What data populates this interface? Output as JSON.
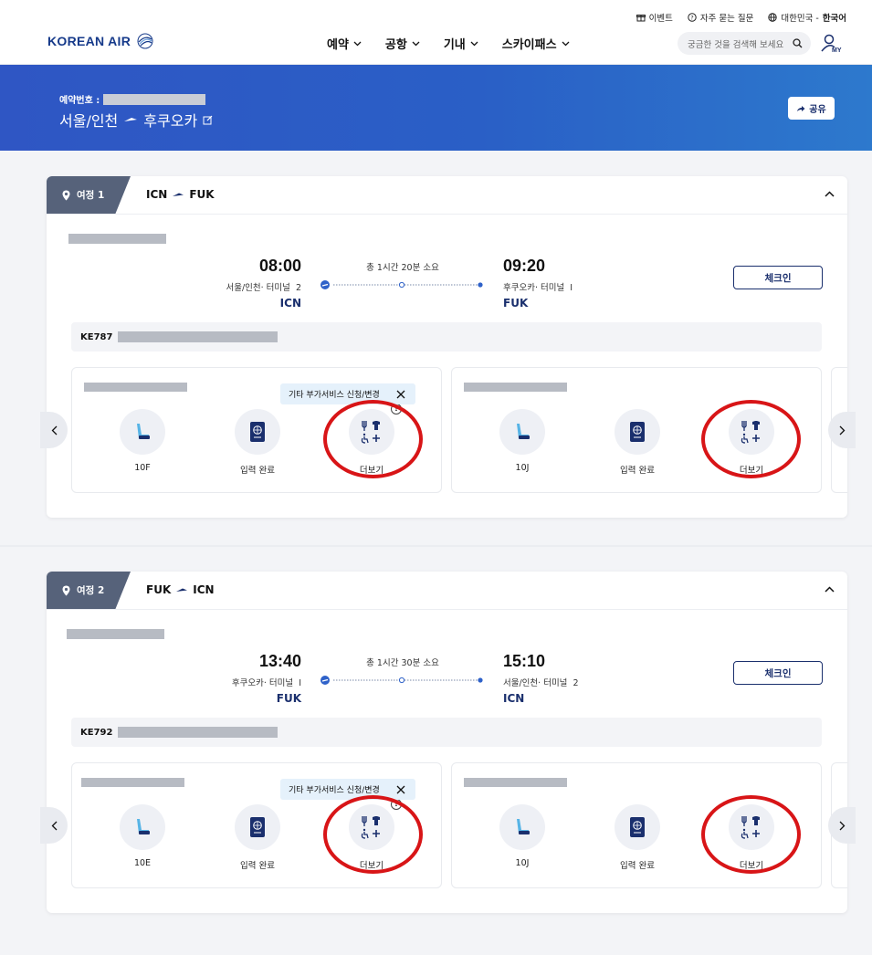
{
  "header": {
    "logo": "KOREAN AIR",
    "utility": [
      {
        "icon": "gift-icon",
        "label": "이벤트"
      },
      {
        "icon": "question-icon",
        "label": "자주 묻는 질문"
      },
      {
        "icon": "globe-icon",
        "label": "대한민국 - ",
        "bold": "한국어"
      }
    ],
    "nav": [
      "예약",
      "공항",
      "기내",
      "스카이패스"
    ],
    "search_placeholder": "궁금한 것을 검색해 보세요",
    "my_label": "MY"
  },
  "hero": {
    "reservation_label": "예약번호 :",
    "route_from": "서울/인천",
    "route_to": "후쿠오카",
    "share_label": "공유"
  },
  "itineraries": [
    {
      "tab": "여정 1",
      "from": "ICN",
      "to": "FUK",
      "dep_time": "08:00",
      "dep_terminal": "서울/인천· 터미널",
      "dep_terminal_no": "2",
      "dep_code": "ICN",
      "arr_time": "09:20",
      "arr_terminal": "후쿠오카· 터미널",
      "arr_terminal_no": "I",
      "duration": "총 1시간 20분 소요",
      "checkin": "체크인",
      "flight_no": "KE787",
      "passengers": [
        {
          "seat": "10F",
          "passport": "입력 완료",
          "more": "더보기"
        },
        {
          "seat": "10J",
          "passport": "입력 완료",
          "more": "더보기"
        }
      ],
      "tooltip": "기타 부가서비스 신청/변경"
    },
    {
      "tab": "여정 2",
      "from": "FUK",
      "to": "ICN",
      "dep_time": "13:40",
      "dep_terminal": "후쿠오카· 터미널",
      "dep_terminal_no": "I",
      "dep_code": "FUK",
      "arr_time": "15:10",
      "arr_terminal": "서울/인천· 터미널",
      "arr_terminal_no": "2",
      "duration": "총 1시간 30분 소요",
      "checkin": "체크인",
      "flight_no": "KE792",
      "passengers": [
        {
          "seat": "10E",
          "passport": "입력 완료",
          "more": "더보기"
        },
        {
          "seat": "10J",
          "passport": "입력 완료",
          "more": "더보기"
        }
      ],
      "tooltip": "기타 부가서비스 신청/변경"
    }
  ],
  "colors": {
    "brand_navy": "#1a2f6d",
    "hero_blue": "#2f56c4",
    "highlight_red": "#d81517",
    "tab_gray": "#56627a"
  }
}
